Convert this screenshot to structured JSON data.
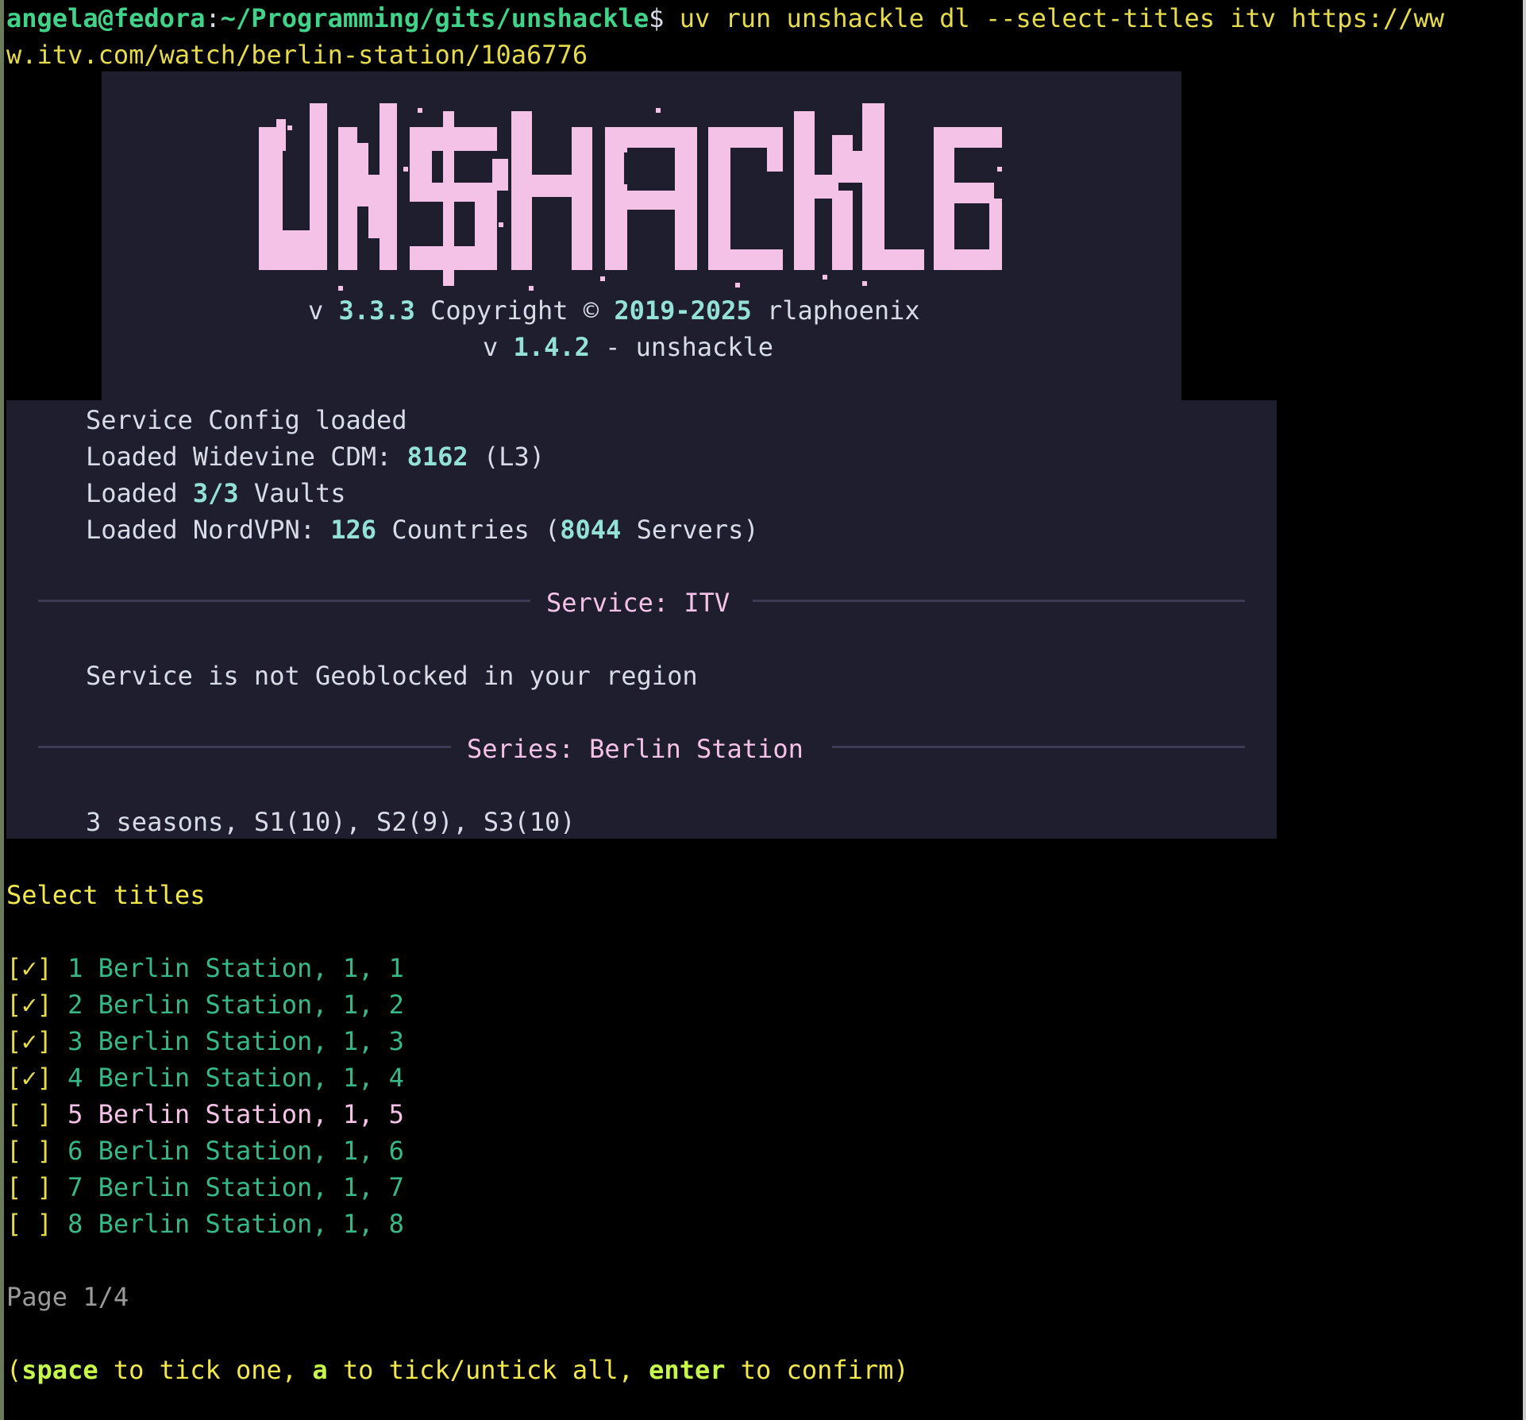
{
  "prompt": {
    "user_host": "angela@fedora",
    "separator": ":",
    "path": "~/Programming/gits/unshackle",
    "dollar": "$",
    "command_line1": " uv run unshackle dl --select-titles itv https://ww",
    "command_line2": "w.itv.com/watch/berlin-station/10a6776"
  },
  "banner": {
    "logo_text": "UNSHACKLE",
    "version_prefix": "v ",
    "version": "3.3.3",
    "copyright": " Copyright © ",
    "years": "2019-2025",
    "author": " rlaphoenix",
    "v2_prefix": "v ",
    "v2_version": "1.4.2",
    "v2_suffix": " - unshackle"
  },
  "info": {
    "service_config": "Service Config loaded",
    "widevine_prefix": "Loaded Widevine CDM: ",
    "widevine_num": "8162",
    "widevine_suffix": " (L3)",
    "vaults_prefix": "Loaded ",
    "vaults_num": "3/3",
    "vaults_suffix": " Vaults",
    "nord_prefix": "Loaded NordVPN: ",
    "nord_countries": "126",
    "nord_mid": " Countries (",
    "nord_servers": "8044",
    "nord_suffix": " Servers)",
    "service_heading": "Service: ITV",
    "geoblock": "Service is not Geoblocked in your region",
    "series_heading": "Series: Berlin Station",
    "seasons": "3 seasons, S1(10), S2(9), S3(10)"
  },
  "selector": {
    "heading": "Select titles",
    "items": [
      {
        "box": "[✓]",
        "label": "1 Berlin Station, 1, 1",
        "checked": true
      },
      {
        "box": "[✓]",
        "label": "2 Berlin Station, 1, 2",
        "checked": true
      },
      {
        "box": "[✓]",
        "label": "3 Berlin Station, 1, 3",
        "checked": true
      },
      {
        "box": "[✓]",
        "label": "4 Berlin Station, 1, 4",
        "checked": true
      },
      {
        "box": "[ ]",
        "label": "5 Berlin Station, 1, 5",
        "checked": false,
        "focused": true
      },
      {
        "box": "[ ]",
        "label": "6 Berlin Station, 1, 6",
        "checked": false
      },
      {
        "box": "[ ]",
        "label": "7 Berlin Station, 1, 7",
        "checked": false
      },
      {
        "box": "[ ]",
        "label": "8 Berlin Station, 1, 8",
        "checked": false
      }
    ],
    "page": "Page 1/4",
    "hint_open": "(",
    "hint_key1": "space",
    "hint_t1": " to tick one, ",
    "hint_key2": "a",
    "hint_t2": " to tick/untick all, ",
    "hint_key3": "enter",
    "hint_t3": " to confirm)"
  },
  "colors": {
    "background": "#000000",
    "panel": "#1e1e2e",
    "accent_pink": "#f5c2e7",
    "accent_teal": "#94e2d5",
    "prompt_green": "#41d38a",
    "command_yellow": "#e6db4a",
    "item_green": "#37b889"
  }
}
